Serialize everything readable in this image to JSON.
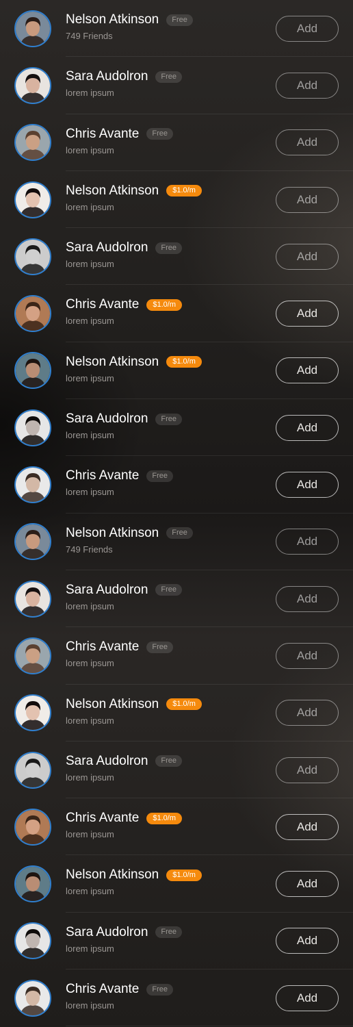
{
  "colors": {
    "accent_ring": "#2f7fcf",
    "paid_badge": "#f58a0d",
    "free_badge": "#4a4745",
    "text_primary": "#ffffff",
    "text_secondary": "#9b9794"
  },
  "contacts": [
    {
      "name": "Nelson Atkinson",
      "badge": "Free",
      "badge_type": "free",
      "subtitle": "749 Friends",
      "button": "Add",
      "avatar_icon": "male-portrait-icon"
    },
    {
      "name": "Sara Audolron",
      "badge": "Free",
      "badge_type": "free",
      "subtitle": "lorem ipsum",
      "button": "Add",
      "avatar_icon": "female-portrait-icon"
    },
    {
      "name": "Chris Avante",
      "badge": "Free",
      "badge_type": "free",
      "subtitle": "lorem ipsum",
      "button": "Add",
      "avatar_icon": "male-portrait-icon"
    },
    {
      "name": "Nelson Atkinson",
      "badge": "$1.0/m",
      "badge_type": "paid",
      "subtitle": "lorem ipsum",
      "button": "Add",
      "avatar_icon": "female-portrait-icon"
    },
    {
      "name": "Sara Audolron",
      "badge": "Free",
      "badge_type": "free",
      "subtitle": "lorem ipsum",
      "button": "Add",
      "avatar_icon": "female-portrait-icon"
    },
    {
      "name": "Chris Avante",
      "badge": "$1.0/m",
      "badge_type": "paid",
      "subtitle": "lorem ipsum",
      "button": "Add",
      "avatar_icon": "female-portrait-icon"
    },
    {
      "name": "Nelson Atkinson",
      "badge": "$1.0/m",
      "badge_type": "paid",
      "subtitle": "lorem ipsum",
      "button": "Add",
      "avatar_icon": "male-portrait-icon"
    },
    {
      "name": "Sara Audolron",
      "badge": "Free",
      "badge_type": "free",
      "subtitle": "lorem ipsum",
      "button": "Add",
      "avatar_icon": "female-portrait-icon"
    },
    {
      "name": "Chris Avante",
      "badge": "Free",
      "badge_type": "free",
      "subtitle": "lorem ipsum",
      "button": "Add",
      "avatar_icon": "male-portrait-icon"
    },
    {
      "name": "Nelson Atkinson",
      "badge": "Free",
      "badge_type": "free",
      "subtitle": "749 Friends",
      "button": "Add",
      "avatar_icon": "male-portrait-icon"
    },
    {
      "name": "Sara Audolron",
      "badge": "Free",
      "badge_type": "free",
      "subtitle": "lorem ipsum",
      "button": "Add",
      "avatar_icon": "female-portrait-icon"
    },
    {
      "name": "Chris Avante",
      "badge": "Free",
      "badge_type": "free",
      "subtitle": "lorem ipsum",
      "button": "Add",
      "avatar_icon": "male-portrait-icon"
    },
    {
      "name": "Nelson Atkinson",
      "badge": "$1.0/m",
      "badge_type": "paid",
      "subtitle": "lorem ipsum",
      "button": "Add",
      "avatar_icon": "female-portrait-icon"
    },
    {
      "name": "Sara Audolron",
      "badge": "Free",
      "badge_type": "free",
      "subtitle": "lorem ipsum",
      "button": "Add",
      "avatar_icon": "female-portrait-icon"
    },
    {
      "name": "Chris Avante",
      "badge": "$1.0/m",
      "badge_type": "paid",
      "subtitle": "lorem ipsum",
      "button": "Add",
      "avatar_icon": "female-portrait-icon"
    },
    {
      "name": "Nelson Atkinson",
      "badge": "$1.0/m",
      "badge_type": "paid",
      "subtitle": "lorem ipsum",
      "button": "Add",
      "avatar_icon": "male-portrait-icon"
    },
    {
      "name": "Sara Audolron",
      "badge": "Free",
      "badge_type": "free",
      "subtitle": "lorem ipsum",
      "button": "Add",
      "avatar_icon": "female-portrait-icon"
    },
    {
      "name": "Chris Avante",
      "badge": "Free",
      "badge_type": "free",
      "subtitle": "lorem ipsum",
      "button": "Add",
      "avatar_icon": "male-portrait-icon"
    }
  ]
}
